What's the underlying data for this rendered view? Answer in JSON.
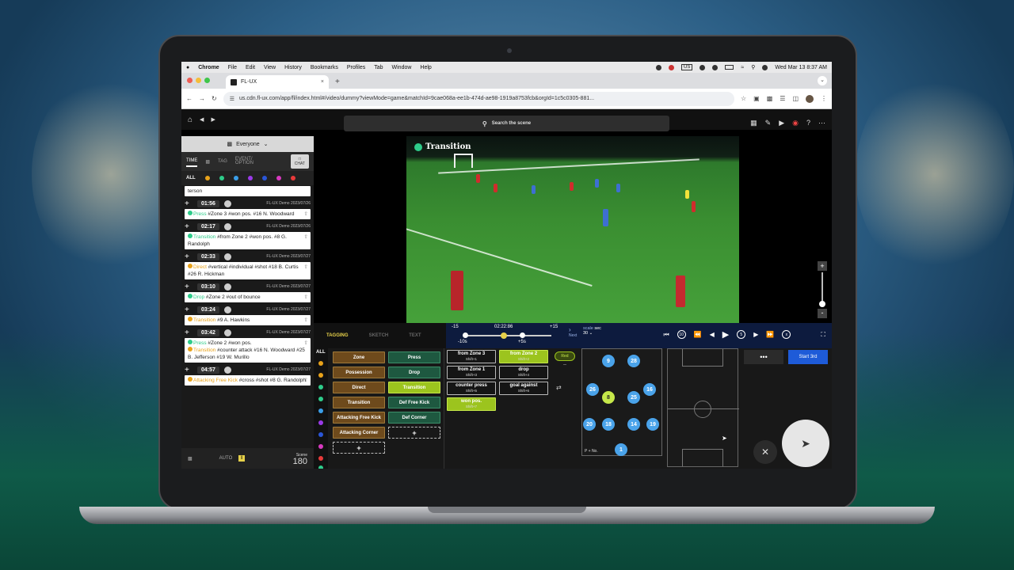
{
  "menubar": {
    "app": "Chrome",
    "items": [
      "File",
      "Edit",
      "View",
      "History",
      "Bookmarks",
      "Profiles",
      "Tab",
      "Window",
      "Help"
    ],
    "clock": "Wed Mar 13  8:37 AM",
    "input_badge": "US"
  },
  "browser": {
    "tab_title": "FL-UX",
    "url": "us.cdn.fl-ux.com/app/fl/index.html#/video/dummy?viewMode=game&matchId=9cae068a-ee1b-474d-ae98-1919a8753fcb&orgId=1c5c0305-881..."
  },
  "header": {
    "search_placeholder": "Search the scene"
  },
  "leftpanel": {
    "audience": "Everyone",
    "modes": [
      "TIME",
      "TAG",
      "EVENT/ OPTION",
      "CHAT"
    ],
    "filter_all": "ALL",
    "first_fragment": "terson",
    "events": [
      {
        "time": "01:56",
        "owner": "FL-UX Demo",
        "date": "2023/07/26",
        "lines": [
          {
            "tag": "Press",
            "color": "#2ecc8a",
            "text": " #Zone 3 #won pos. #16 N. Woodward"
          }
        ]
      },
      {
        "time": "02:17",
        "owner": "FL-UX Demo",
        "date": "2023/07/26",
        "lines": [
          {
            "tag": "Transition",
            "color": "#2ecc8a",
            "text": " #from Zone 2 #won pos. #8 G. Randolph"
          }
        ]
      },
      {
        "time": "02:33",
        "owner": "FL-UX Demo",
        "date": "2023/07/27",
        "lines": [
          {
            "tag": "Direct",
            "color": "#e8a21a",
            "text": " #vertical #individual #shot #18 B. Curtis #26 R. Hickman"
          }
        ]
      },
      {
        "time": "03:10",
        "owner": "FL-UX Demo",
        "date": "2023/07/27",
        "lines": [
          {
            "tag": "Drop",
            "color": "#2ecc8a",
            "text": " #Zone 2 #out of bounce"
          }
        ]
      },
      {
        "time": "03:24",
        "owner": "FL-UX Demo",
        "date": "2023/07/27",
        "lines": [
          {
            "tag": "Transition",
            "color": "#e8a21a",
            "text": " #9 A. Hawkins"
          }
        ]
      },
      {
        "time": "03:42",
        "owner": "FL-UX Demo",
        "date": "2023/07/27",
        "lines": [
          {
            "tag": "Press",
            "color": "#2ecc8a",
            "text": " #Zone 2 #won pos."
          },
          {
            "tag": "Transition",
            "color": "#e8a21a",
            "text": " #counter attack #16 N. Woodward #25 B. Jefferson #19 W. Murillo"
          }
        ]
      },
      {
        "time": "04:57",
        "owner": "FL-UX Demo",
        "date": "2023/07/27",
        "lines": [
          {
            "tag": "Attacking Free Kick",
            "color": "#e8a21a",
            "text": " #cross #shot #8 G. Randolph"
          }
        ]
      }
    ],
    "footer_mode": "AUTO",
    "scene_label": "Scene",
    "scene_count": "180"
  },
  "video": {
    "title": "Transition"
  },
  "timeline": {
    "tabs": [
      "TAGGING",
      "SKETCH",
      "TEXT"
    ],
    "start": "-15",
    "end": "+15",
    "current": "02:22:86",
    "back": "-10s",
    "fwd": "+5s",
    "next_label": "Next",
    "scale_label": "scale",
    "scale_unit": "sec",
    "scale_value": "30"
  },
  "tagging": {
    "all": "ALL",
    "col1": [
      "Zone",
      "Possession",
      "Direct",
      "Transition",
      "Attacking Free Kick",
      "Attacking Corner"
    ],
    "col2": [
      "Press",
      "Drop",
      "Transition",
      "Def Free Kick",
      "Def Corner"
    ],
    "col3": [
      {
        "label": "from Zone 3",
        "key": "Shift+1"
      },
      {
        "label": "from Zone 2",
        "key": "Shift+2"
      },
      {
        "label": "from Zone 1",
        "key": "Shift+3"
      },
      {
        "label": "drop",
        "key": "Shift+4"
      },
      {
        "label": "counter press",
        "key": "Shift+5"
      },
      {
        "label": "goal against",
        "key": "Shift+6"
      },
      {
        "label": "won pos.",
        "key": "Shift+7"
      }
    ],
    "team_red": "Red",
    "team_more": "--",
    "formation_label": "P + No.",
    "players": [
      "9",
      "28",
      "26",
      "8",
      "25",
      "16",
      "20",
      "18",
      "14",
      "19",
      "1"
    ],
    "more": "•••",
    "start_btn": "Start 3rd",
    "plus": "+"
  },
  "colors": {
    "accent_green": "#2ecc8a",
    "accent_orange": "#e8a21a",
    "start_blue": "#1e5bd8"
  }
}
